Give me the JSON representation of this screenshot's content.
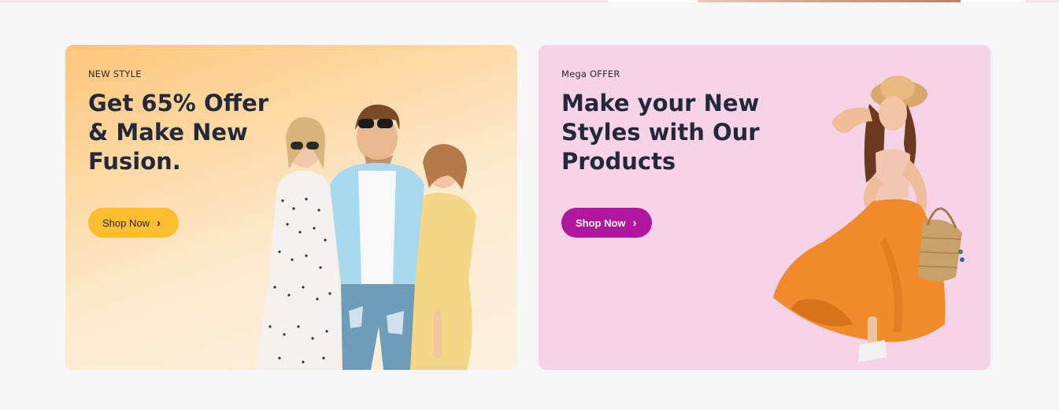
{
  "banners": [
    {
      "eyebrow": "NEW STYLE",
      "headline": "Get 65% Offer & Make New Fusion.",
      "button_label": "Shop Now",
      "button_icon": "chevron-right-icon",
      "accent": "#ffbd2e",
      "background": "#fdd9a4"
    },
    {
      "eyebrow": "Mega OFFER",
      "headline": "Make your New Styles with Our Products",
      "button_label": "Shop Now",
      "button_icon": "chevron-right-icon",
      "accent": "#b0179e",
      "background": "#f6d3e7"
    }
  ]
}
